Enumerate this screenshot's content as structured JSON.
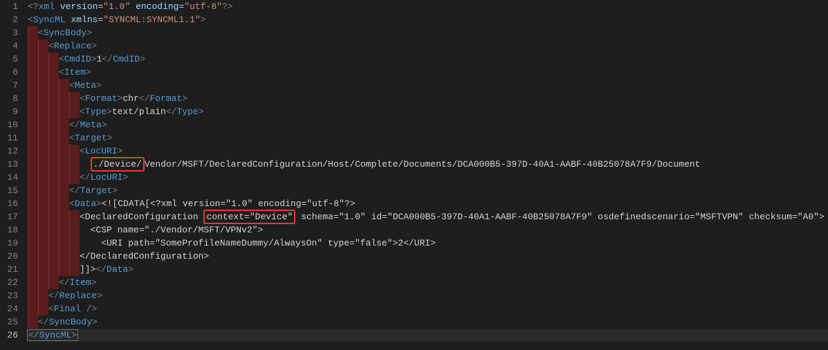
{
  "lines": [
    {
      "n": 1,
      "indents": 0,
      "marked": false,
      "segs": [
        {
          "c": "tagp",
          "t": "<?"
        },
        {
          "c": "tagn",
          "t": "xml"
        },
        {
          "c": "txt",
          "t": " "
        },
        {
          "c": "attn",
          "t": "version"
        },
        {
          "c": "txt",
          "t": "="
        },
        {
          "c": "attv",
          "t": "\"1.0\""
        },
        {
          "c": "txt",
          "t": " "
        },
        {
          "c": "attn",
          "t": "encoding"
        },
        {
          "c": "txt",
          "t": "="
        },
        {
          "c": "attv",
          "t": "\"utf-8\""
        },
        {
          "c": "tagp",
          "t": "?>"
        }
      ]
    },
    {
      "n": 2,
      "indents": 0,
      "marked": false,
      "segs": [
        {
          "c": "tagp",
          "t": "<"
        },
        {
          "c": "tagn",
          "t": "SyncML"
        },
        {
          "c": "txt",
          "t": " "
        },
        {
          "c": "attn",
          "t": "xmlns"
        },
        {
          "c": "txt",
          "t": "="
        },
        {
          "c": "attv",
          "t": "\"SYNCML:SYNCML1.1\""
        },
        {
          "c": "tagp",
          "t": ">"
        }
      ]
    },
    {
      "n": 3,
      "indents": 1,
      "marked": true,
      "segs": [
        {
          "c": "tagp",
          "t": "<"
        },
        {
          "c": "tagn",
          "t": "SyncBody"
        },
        {
          "c": "tagp",
          "t": ">"
        }
      ]
    },
    {
      "n": 4,
      "indents": 2,
      "marked": true,
      "segs": [
        {
          "c": "tagp",
          "t": "<"
        },
        {
          "c": "tagn",
          "t": "Replace"
        },
        {
          "c": "tagp",
          "t": ">"
        }
      ]
    },
    {
      "n": 5,
      "indents": 3,
      "marked": true,
      "segs": [
        {
          "c": "tagp",
          "t": "<"
        },
        {
          "c": "tagn",
          "t": "CmdID"
        },
        {
          "c": "tagp",
          "t": ">"
        },
        {
          "c": "txt",
          "t": "1"
        },
        {
          "c": "tagp",
          "t": "</"
        },
        {
          "c": "tagn",
          "t": "CmdID"
        },
        {
          "c": "tagp",
          "t": ">"
        }
      ]
    },
    {
      "n": 6,
      "indents": 3,
      "marked": true,
      "segs": [
        {
          "c": "tagp",
          "t": "<"
        },
        {
          "c": "tagn",
          "t": "Item"
        },
        {
          "c": "tagp",
          "t": ">"
        }
      ]
    },
    {
      "n": 7,
      "indents": 4,
      "marked": true,
      "segs": [
        {
          "c": "tagp",
          "t": "<"
        },
        {
          "c": "tagn",
          "t": "Meta"
        },
        {
          "c": "tagp",
          "t": ">"
        }
      ]
    },
    {
      "n": 8,
      "indents": 5,
      "marked": true,
      "segs": [
        {
          "c": "tagp",
          "t": "<"
        },
        {
          "c": "tagn",
          "t": "Format"
        },
        {
          "c": "tagp",
          "t": ">"
        },
        {
          "c": "txt",
          "t": "chr"
        },
        {
          "c": "tagp",
          "t": "</"
        },
        {
          "c": "tagn",
          "t": "Format"
        },
        {
          "c": "tagp",
          "t": ">"
        }
      ]
    },
    {
      "n": 9,
      "indents": 5,
      "marked": true,
      "segs": [
        {
          "c": "tagp",
          "t": "<"
        },
        {
          "c": "tagn",
          "t": "Type"
        },
        {
          "c": "tagp",
          "t": ">"
        },
        {
          "c": "txt",
          "t": "text/plain"
        },
        {
          "c": "tagp",
          "t": "</"
        },
        {
          "c": "tagn",
          "t": "Type"
        },
        {
          "c": "tagp",
          "t": ">"
        }
      ]
    },
    {
      "n": 10,
      "indents": 4,
      "marked": true,
      "segs": [
        {
          "c": "tagp",
          "t": "</"
        },
        {
          "c": "tagn",
          "t": "Meta"
        },
        {
          "c": "tagp",
          "t": ">"
        }
      ]
    },
    {
      "n": 11,
      "indents": 4,
      "marked": true,
      "segs": [
        {
          "c": "tagp",
          "t": "<"
        },
        {
          "c": "tagn",
          "t": "Target"
        },
        {
          "c": "tagp",
          "t": ">"
        }
      ]
    },
    {
      "n": 12,
      "indents": 5,
      "marked": true,
      "segs": [
        {
          "c": "tagp",
          "t": "<"
        },
        {
          "c": "tagn",
          "t": "LocURI"
        },
        {
          "c": "tagp",
          "t": ">"
        }
      ]
    },
    {
      "n": 13,
      "indents": 5,
      "marked": true,
      "segs": [
        {
          "c": "txt",
          "t": "  "
        },
        {
          "hl": true,
          "c": "txt",
          "t": "./Device/"
        },
        {
          "c": "txt",
          "t": "Vendor/MSFT/DeclaredConfiguration/Host/Complete/Documents/DCA000B5-397D-40A1-AABF-40B25078A7F9/Document"
        }
      ]
    },
    {
      "n": 14,
      "indents": 5,
      "marked": true,
      "segs": [
        {
          "c": "tagp",
          "t": "</"
        },
        {
          "c": "tagn",
          "t": "LocURI"
        },
        {
          "c": "tagp",
          "t": ">"
        }
      ]
    },
    {
      "n": 15,
      "indents": 4,
      "marked": true,
      "segs": [
        {
          "c": "tagp",
          "t": "</"
        },
        {
          "c": "tagn",
          "t": "Target"
        },
        {
          "c": "tagp",
          "t": ">"
        }
      ]
    },
    {
      "n": 16,
      "indents": 4,
      "marked": true,
      "segs": [
        {
          "c": "tagp",
          "t": "<"
        },
        {
          "c": "tagn",
          "t": "Data"
        },
        {
          "c": "tagp",
          "t": ">"
        },
        {
          "c": "txt",
          "t": "<![CDATA[<?xml version=\"1.0\" encoding=\"utf-8\"?>"
        }
      ]
    },
    {
      "n": 17,
      "indents": 5,
      "marked": true,
      "segs": [
        {
          "c": "txt",
          "t": "<DeclaredConfiguration "
        },
        {
          "hl": true,
          "c": "txt",
          "t": "context=\"Device\""
        },
        {
          "c": "txt",
          "t": " schema=\"1.0\" id=\"DCA000B5-397D-40A1-AABF-40B25078A7F9\" osdefinedscenario=\"MSFTVPN\" checksum=\"A0\">"
        }
      ]
    },
    {
      "n": 18,
      "indents": 5,
      "marked": true,
      "segs": [
        {
          "c": "txt",
          "t": "  <CSP name=\"./Vendor/MSFT/VPNv2\">"
        }
      ]
    },
    {
      "n": 19,
      "indents": 5,
      "marked": true,
      "segs": [
        {
          "c": "txt",
          "t": "    <URI path=\"SomeProfileNameDummy/AlwaysOn\" type=\"false\">2</URI>"
        }
      ]
    },
    {
      "n": 20,
      "indents": 5,
      "marked": true,
      "segs": [
        {
          "c": "txt",
          "t": "</DeclaredConfiguration>"
        }
      ]
    },
    {
      "n": 21,
      "indents": 5,
      "marked": true,
      "segs": [
        {
          "c": "txt",
          "t": "]]>"
        },
        {
          "c": "tagp",
          "t": "</"
        },
        {
          "c": "tagn",
          "t": "Data"
        },
        {
          "c": "tagp",
          "t": ">"
        }
      ]
    },
    {
      "n": 22,
      "indents": 3,
      "marked": true,
      "segs": [
        {
          "c": "tagp",
          "t": "</"
        },
        {
          "c": "tagn",
          "t": "Item"
        },
        {
          "c": "tagp",
          "t": ">"
        }
      ]
    },
    {
      "n": 23,
      "indents": 2,
      "marked": true,
      "segs": [
        {
          "c": "tagp",
          "t": "</"
        },
        {
          "c": "tagn",
          "t": "Replace"
        },
        {
          "c": "tagp",
          "t": ">"
        }
      ]
    },
    {
      "n": 24,
      "indents": 2,
      "marked": true,
      "segs": [
        {
          "c": "tagp",
          "t": "<"
        },
        {
          "c": "tagn",
          "t": "Final"
        },
        {
          "c": "txt",
          "t": " "
        },
        {
          "c": "tagp",
          "t": "/>"
        }
      ]
    },
    {
      "n": 25,
      "indents": 1,
      "marked": true,
      "segs": [
        {
          "c": "tagp",
          "t": "</"
        },
        {
          "c": "tagn",
          "t": "SyncBody"
        },
        {
          "c": "tagp",
          "t": ">"
        }
      ]
    },
    {
      "n": 26,
      "indents": 0,
      "marked": false,
      "active": true,
      "segs": [
        {
          "sel": true,
          "parts": [
            {
              "c": "tagp",
              "t": "</"
            },
            {
              "c": "tagn",
              "t": "SyncML"
            },
            {
              "c": "tagp",
              "t": ">"
            }
          ]
        },
        {
          "cursor": true
        }
      ]
    }
  ]
}
